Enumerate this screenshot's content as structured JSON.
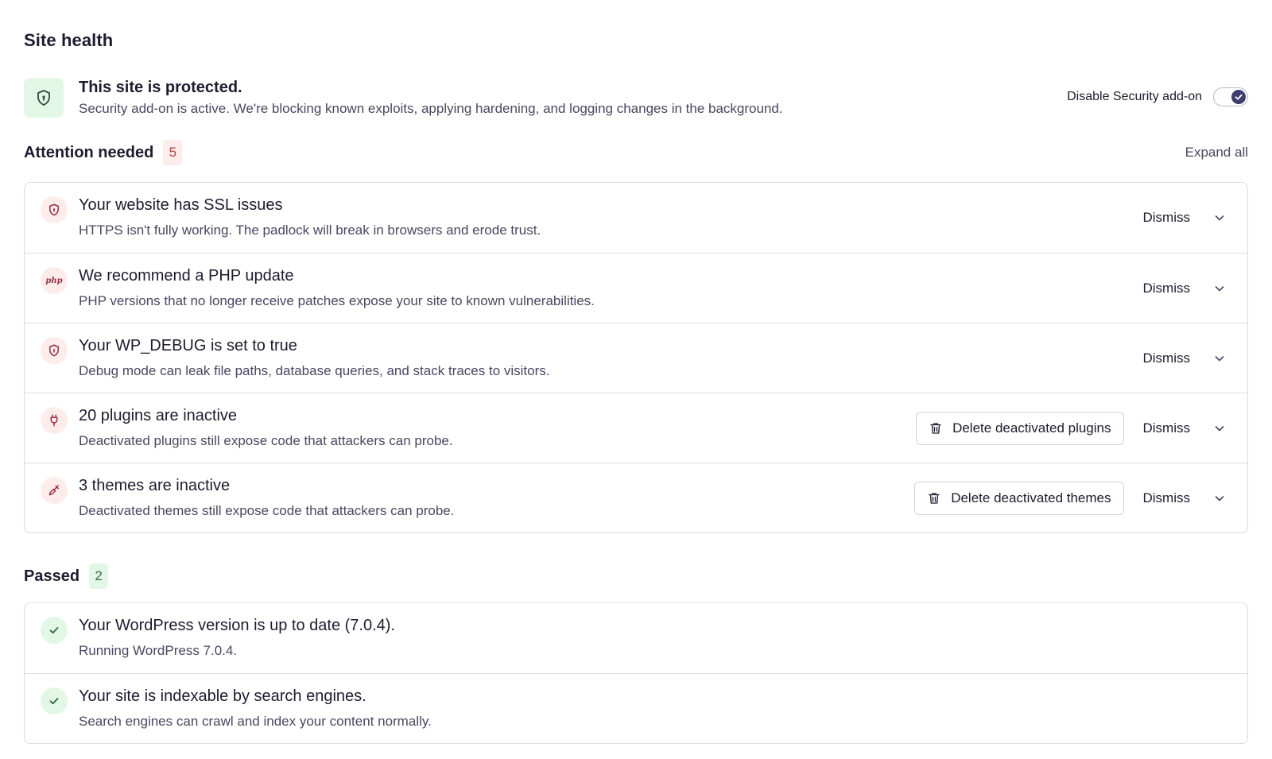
{
  "page": {
    "title": "Site health"
  },
  "banner": {
    "icon": "shield-icon",
    "title": "This site is protected.",
    "description": "Security add-on is active. We're blocking known exploits, applying hardening, and logging changes in the background.",
    "toggle_label": "Disable Security add-on",
    "toggle_on": true
  },
  "attention": {
    "title": "Attention needed",
    "count": "5",
    "expand_label": "Expand all",
    "items": [
      {
        "icon": "shield-icon",
        "title": "Your website has SSL issues",
        "description": "HTTPS isn't fully working. The padlock will break in browsers and erode trust.",
        "dismiss": "Dismiss"
      },
      {
        "icon": "php-icon",
        "icon_text": "php",
        "title": "We recommend a PHP update",
        "description": "PHP versions that no longer receive patches expose your site to known vulnerabilities.",
        "dismiss": "Dismiss"
      },
      {
        "icon": "shield-icon",
        "title": "Your WP_DEBUG is set to true",
        "description": "Debug mode can leak file paths, database queries, and stack traces to visitors.",
        "dismiss": "Dismiss"
      },
      {
        "icon": "plug-icon",
        "title": "20 plugins are inactive",
        "description": "Deactivated plugins still expose code that attackers can probe.",
        "action": "Delete deactivated plugins",
        "dismiss": "Dismiss"
      },
      {
        "icon": "brush-icon",
        "title": "3 themes are inactive",
        "description": "Deactivated themes still expose code that attackers can probe.",
        "action": "Delete deactivated themes",
        "dismiss": "Dismiss"
      }
    ]
  },
  "passed": {
    "title": "Passed",
    "count": "2",
    "items": [
      {
        "icon": "check-icon",
        "title": "Your WordPress version is up to date (7.0.4).",
        "description": "Running WordPress 7.0.4."
      },
      {
        "icon": "check-icon",
        "title": "Your site is indexable by search engines.",
        "description": "Search engines can crawl and index your content normally."
      }
    ]
  },
  "colors": {
    "accent": "#3f3d6e",
    "warning": "#9b2f44",
    "success": "#2f6b3c",
    "warning_bg": "#fdecec",
    "success_bg": "#e3f7e6"
  }
}
